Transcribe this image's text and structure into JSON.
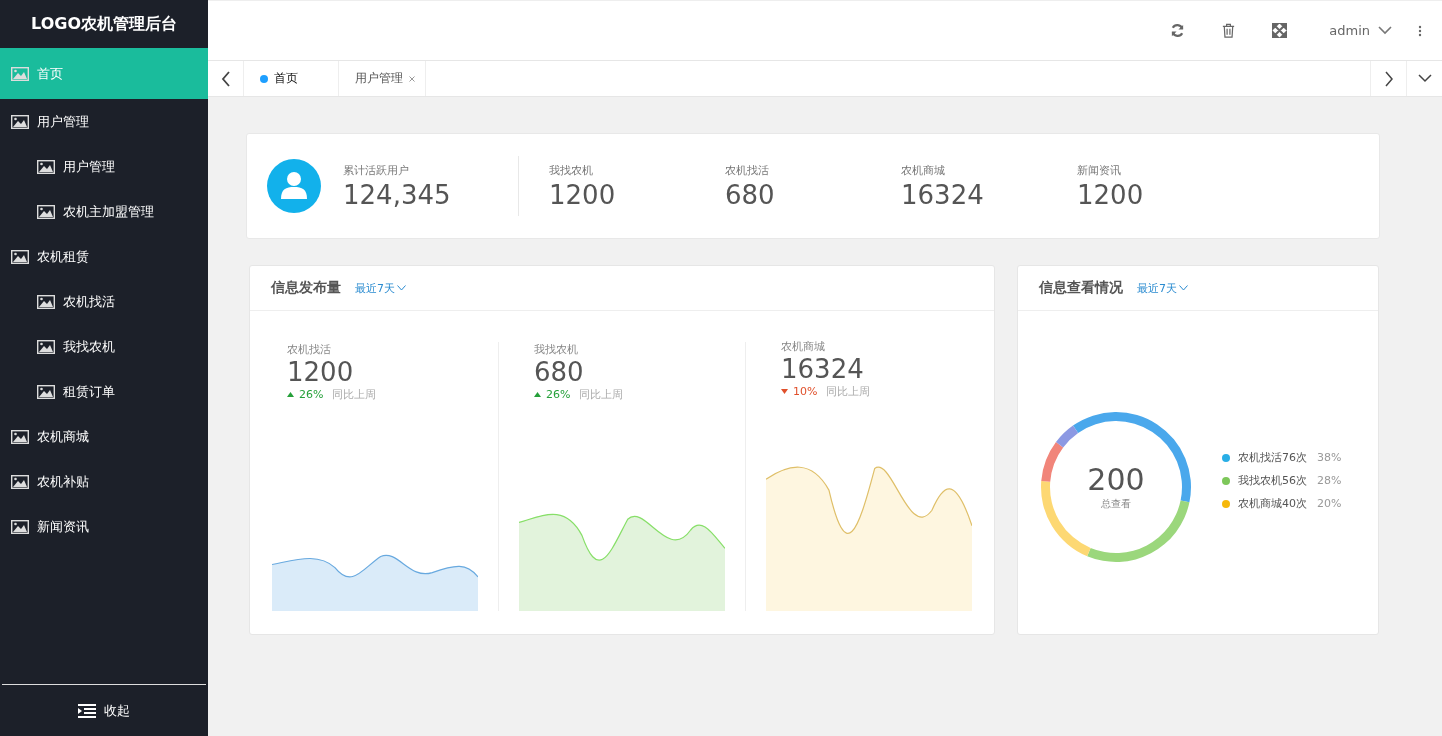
{
  "sidebar": {
    "logo": "LOGO农机管理后台",
    "items": [
      {
        "label": "首页",
        "selected": true
      },
      {
        "label": "用户管理",
        "selected": false,
        "children": [
          {
            "label": "用户管理",
            "selected": false
          },
          {
            "label": "农机主加盟管理",
            "selected": false
          }
        ]
      },
      {
        "label": "农机租赁",
        "selected": false,
        "children": [
          {
            "label": "农机找活",
            "selected": false
          },
          {
            "label": "我找农机",
            "selected": false
          },
          {
            "label": "租赁订单",
            "selected": false
          }
        ]
      },
      {
        "label": "农机商城",
        "selected": false
      },
      {
        "label": "农机补贴",
        "selected": false
      },
      {
        "label": "新闻资讯",
        "selected": false
      }
    ],
    "collapse": "收起"
  },
  "header": {
    "user": "admin"
  },
  "tabs": [
    {
      "label": "首页",
      "selected": true,
      "closable": false
    },
    {
      "label": "用户管理",
      "selected": false,
      "closable": true
    }
  ],
  "summary": {
    "primary": {
      "label": "累计活跃用户",
      "value": "124,345"
    },
    "stats": [
      {
        "label": "我找农机",
        "value": "1200"
      },
      {
        "label": "农机找活",
        "value": "680"
      },
      {
        "label": "农机商城",
        "value": "16324"
      },
      {
        "label": "新闻资讯",
        "value": "1200"
      }
    ]
  },
  "publish_panel": {
    "title": "信息发布量",
    "range": "最近7天",
    "metrics": [
      {
        "label": "农机找活",
        "value": "1200",
        "rising": true,
        "change": "26%",
        "compare": "同比上周",
        "color": "#daebf9"
      },
      {
        "label": "我找农机",
        "value": "680",
        "rising": true,
        "change": "26%",
        "compare": "同比上周",
        "color": "#e2f3dc"
      },
      {
        "label": "农机商城",
        "value": "16324",
        "rising": false,
        "change": "10%",
        "compare": "同比上周",
        "color": "#fef6e0"
      }
    ]
  },
  "view_panel": {
    "title": "信息查看情况",
    "range": "最近7天",
    "total": "200",
    "total_label": "总查看",
    "legend": [
      {
        "label": "农机找活76次",
        "percent": "38%",
        "color": "#29aee6"
      },
      {
        "label": "我找农机56次",
        "percent": "28%",
        "color": "#7dc75a"
      },
      {
        "label": "农机商城40次",
        "percent": "20%",
        "color": "#f6b80b"
      }
    ]
  }
}
